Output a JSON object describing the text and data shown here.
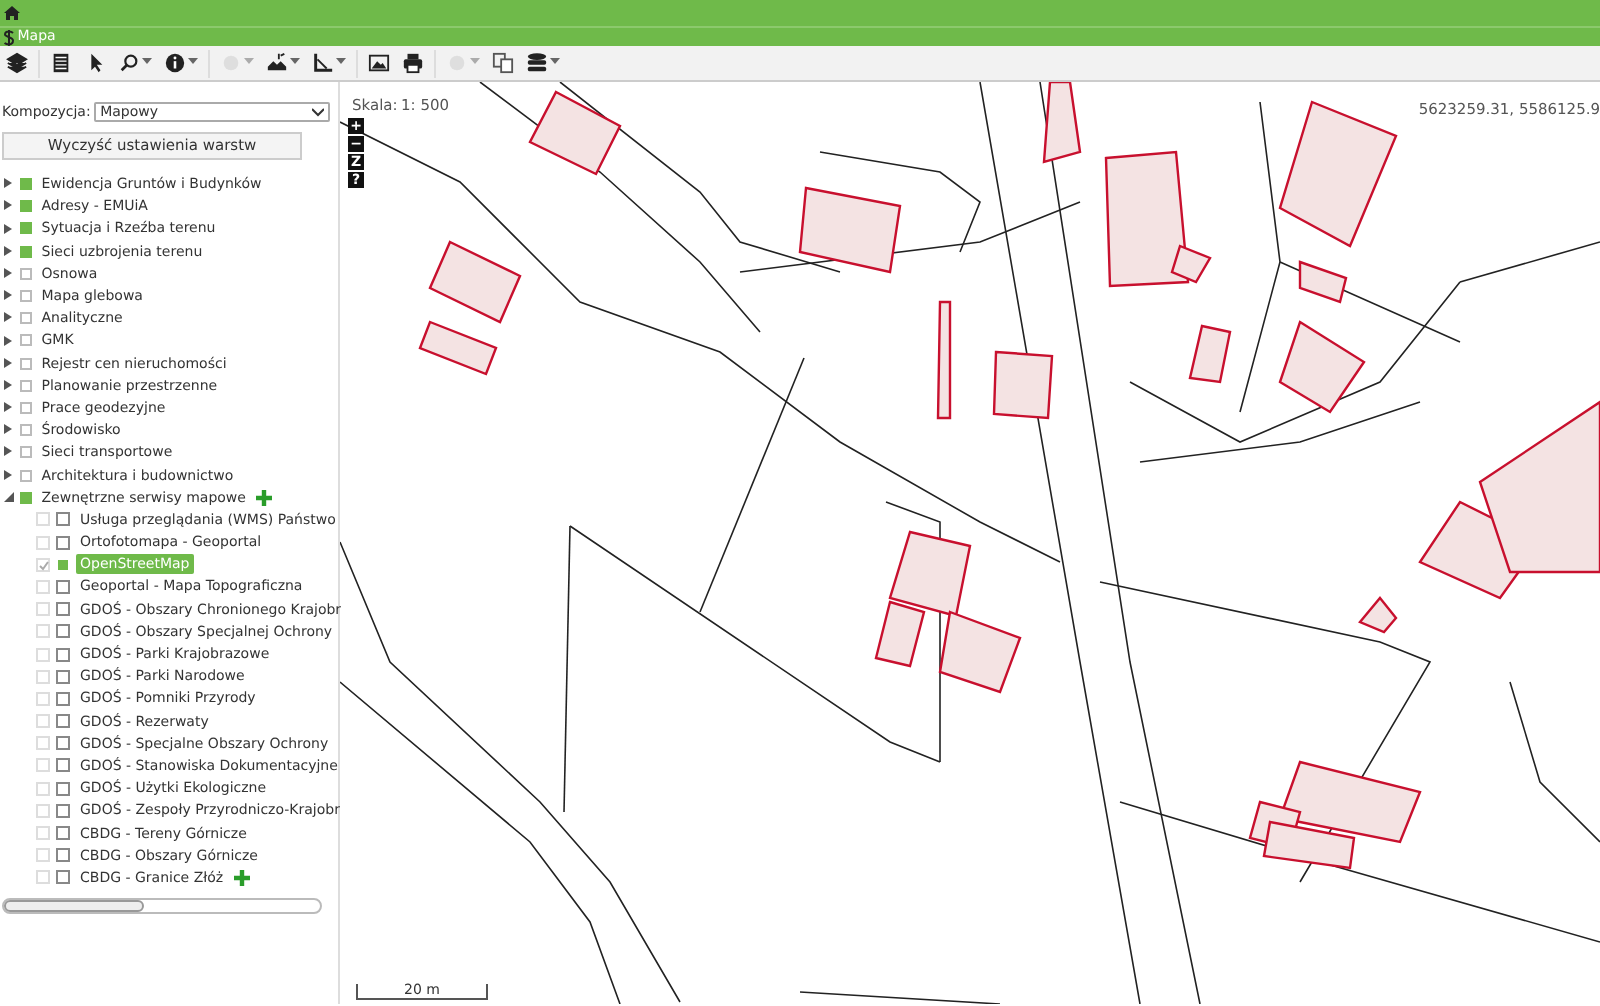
{
  "window": {
    "title": "Mapa"
  },
  "toolbar": [
    {
      "kind": "layers",
      "dropdown": false,
      "disabled": false
    },
    {
      "kind": "table",
      "dropdown": false,
      "disabled": false
    },
    {
      "kind": "pointer",
      "dropdown": false,
      "disabled": false
    },
    {
      "kind": "search",
      "dropdown": true,
      "disabled": false
    },
    {
      "kind": "info",
      "dropdown": true,
      "disabled": false
    },
    {
      "kind": "circle",
      "dropdown": true,
      "disabled": true
    },
    {
      "kind": "tools",
      "dropdown": true,
      "disabled": false
    },
    {
      "kind": "measure",
      "dropdown": true,
      "disabled": false
    },
    {
      "kind": "image",
      "dropdown": false,
      "disabled": false
    },
    {
      "kind": "print",
      "dropdown": false,
      "disabled": false
    },
    {
      "kind": "circle",
      "dropdown": true,
      "disabled": true
    },
    {
      "kind": "copy",
      "dropdown": false,
      "disabled": false
    },
    {
      "kind": "database",
      "dropdown": true,
      "disabled": false
    }
  ],
  "composition": {
    "label": "Kompozycja:",
    "value": "Mapowy"
  },
  "clear_button": "Wyczyść ustawienia warstw",
  "layers": [
    {
      "label": "Ewidencja Gruntów i Budynków",
      "checked": true,
      "expanded": false
    },
    {
      "label": "Adresy - EMUiA",
      "checked": true,
      "expanded": false
    },
    {
      "label": "Sytuacja i Rzeźba terenu",
      "checked": true,
      "expanded": false
    },
    {
      "label": "Sieci uzbrojenia terenu",
      "checked": true,
      "expanded": false
    },
    {
      "label": "Osnowa",
      "checked": false,
      "expanded": false
    },
    {
      "label": "Mapa glebowa",
      "checked": false,
      "expanded": false
    },
    {
      "label": "Analityczne",
      "checked": false,
      "expanded": false
    },
    {
      "label": "GMK",
      "checked": false,
      "expanded": false
    },
    {
      "label": "Rejestr cen nieruchomości",
      "checked": false,
      "expanded": false
    },
    {
      "label": "Planowanie przestrzenne",
      "checked": false,
      "expanded": false
    },
    {
      "label": "Prace geodezyjne",
      "checked": false,
      "expanded": false
    },
    {
      "label": "Środowisko",
      "checked": false,
      "expanded": false
    },
    {
      "label": "Sieci transportowe",
      "checked": false,
      "expanded": false
    },
    {
      "label": "Architektura i budownictwo",
      "checked": false,
      "expanded": false
    },
    {
      "label": "Zewnętrzne serwisy mapowe",
      "checked": true,
      "expanded": true,
      "add": true,
      "children": [
        {
          "label": "Usługa przeglądania (WMS) Państwo",
          "checked": false,
          "selected": false
        },
        {
          "label": "Ortofotomapa - Geoportal",
          "checked": false,
          "selected": false
        },
        {
          "label": "OpenStreetMap",
          "checked": true,
          "selected": true
        },
        {
          "label": "Geoportal - Mapa Topograficzna",
          "checked": false,
          "selected": false
        },
        {
          "label": "GDOŚ - Obszary Chronionego Krajobr",
          "checked": false,
          "selected": false
        },
        {
          "label": "GDOŚ - Obszary Specjalnej Ochrony",
          "checked": false,
          "selected": false
        },
        {
          "label": "GDOŚ - Parki Krajobrazowe",
          "checked": false,
          "selected": false
        },
        {
          "label": "GDOŚ - Parki Narodowe",
          "checked": false,
          "selected": false
        },
        {
          "label": "GDOŚ - Pomniki Przyrody",
          "checked": false,
          "selected": false
        },
        {
          "label": "GDOŚ - Rezerwaty",
          "checked": false,
          "selected": false
        },
        {
          "label": "GDOŚ - Specjalne Obszary Ochrony",
          "checked": false,
          "selected": false
        },
        {
          "label": "GDOŚ - Stanowiska Dokumentacyjne",
          "checked": false,
          "selected": false
        },
        {
          "label": "GDOŚ - Użytki Ekologiczne",
          "checked": false,
          "selected": false
        },
        {
          "label": "GDOŚ - Zespoły Przyrodniczo-Krajobr",
          "checked": false,
          "selected": false
        },
        {
          "label": "CBDG - Tereny Górnicze",
          "checked": false,
          "selected": false
        },
        {
          "label": "CBDG - Obszary Górnicze",
          "checked": false,
          "selected": false
        },
        {
          "label": "CBDG - Granice Złóż",
          "checked": false,
          "selected": false,
          "add": true
        }
      ]
    }
  ],
  "map": {
    "scale_label": "Skala:",
    "scale_value": "1: 500",
    "zoom_controls": [
      "+",
      "−",
      "Z",
      "?"
    ],
    "coordinates": "5623259.31, 5586125.9",
    "scale_bar": "20 m"
  }
}
